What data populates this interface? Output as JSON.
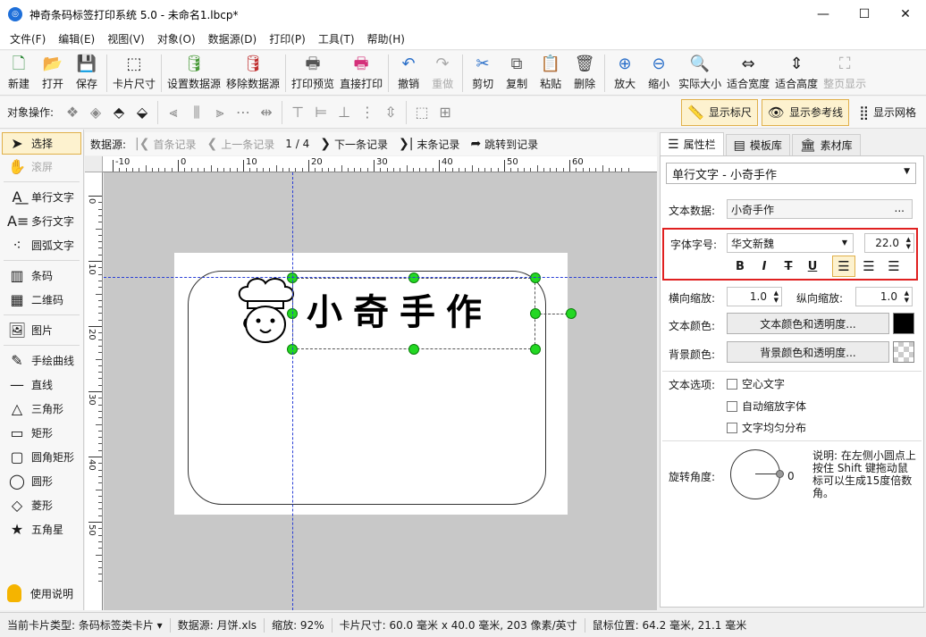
{
  "window": {
    "title": "神奇条码标签打印系统 5.0 - 未命名1.lbcp*",
    "minimize": "—",
    "maximize": "☐",
    "close": "✕"
  },
  "menu": [
    "文件(F)",
    "编辑(E)",
    "视图(V)",
    "对象(O)",
    "数据源(D)",
    "打印(P)",
    "工具(T)",
    "帮助(H)"
  ],
  "toolbar": [
    {
      "label": "新建",
      "icon": "new-file-icon",
      "glyph": "🗋",
      "color": "#2f8a3a"
    },
    {
      "label": "打开",
      "icon": "open-file-icon",
      "glyph": "📂",
      "color": "#2a74c9"
    },
    {
      "label": "保存",
      "icon": "save-icon",
      "glyph": "💾",
      "color": "#7a3fb3"
    },
    {
      "label": "卡片尺寸",
      "icon": "card-size-icon",
      "glyph": "⬚",
      "color": "#222"
    },
    {
      "label": "设置数据源",
      "icon": "set-datasource-icon",
      "glyph": "🛢",
      "color": "#4a9a3a"
    },
    {
      "label": "移除数据源",
      "icon": "remove-datasource-icon",
      "glyph": "🛢",
      "color": "#c03030"
    },
    {
      "label": "打印预览",
      "icon": "print-preview-icon",
      "glyph": "🖶",
      "color": "#555"
    },
    {
      "label": "直接打印",
      "icon": "print-icon",
      "glyph": "🖶",
      "color": "#d4307a"
    },
    {
      "label": "撤销",
      "icon": "undo-icon",
      "glyph": "↶",
      "color": "#2a6fc9"
    },
    {
      "label": "重做",
      "icon": "redo-icon",
      "glyph": "↷",
      "color": "#aaa",
      "disabled": true
    },
    {
      "label": "剪切",
      "icon": "cut-icon",
      "glyph": "✂",
      "color": "#2a6fc9"
    },
    {
      "label": "复制",
      "icon": "copy-icon",
      "glyph": "⧉",
      "color": "#555"
    },
    {
      "label": "粘贴",
      "icon": "paste-icon",
      "glyph": "📋",
      "color": "#b07a2a"
    },
    {
      "label": "删除",
      "icon": "delete-icon",
      "glyph": "🗑",
      "color": "#444"
    },
    {
      "label": "放大",
      "icon": "zoom-in-icon",
      "glyph": "⊕",
      "color": "#2a6fc9"
    },
    {
      "label": "缩小",
      "icon": "zoom-out-icon",
      "glyph": "⊖",
      "color": "#2a6fc9"
    },
    {
      "label": "实际大小",
      "icon": "actual-size-icon",
      "glyph": "🔍",
      "color": "#2a6fc9"
    },
    {
      "label": "适合宽度",
      "icon": "fit-width-icon",
      "glyph": "⇔",
      "color": "#222"
    },
    {
      "label": "适合高度",
      "icon": "fit-height-icon",
      "glyph": "⇕",
      "color": "#222"
    },
    {
      "label": "整页显示",
      "icon": "full-page-icon",
      "glyph": "⛶",
      "color": "#aaa",
      "disabled": true
    }
  ],
  "ops": {
    "label": "对象操作:",
    "toggles": [
      "显示标尺",
      "显示参考线",
      "显示网格"
    ]
  },
  "tools": {
    "select": "选择",
    "scroll": "滚屏",
    "single_text": "单行文字",
    "multi_text": "多行文字",
    "arc_text": "圆弧文字",
    "barcode": "条码",
    "qrcode": "二维码",
    "image": "图片",
    "freehand": "手绘曲线",
    "line": "直线",
    "triangle": "三角形",
    "rect": "矩形",
    "round_rect": "圆角矩形",
    "circle": "圆形",
    "diamond": "菱形",
    "star": "五角星",
    "help": "使用说明"
  },
  "nav": {
    "label": "数据源:",
    "first": "首条记录",
    "prev": "上一条记录",
    "position": "1 / 4",
    "next": "下一条记录",
    "last": "末条记录",
    "jump": "跳转到记录"
  },
  "ruler": {
    "h_labels": [
      "-10",
      "0",
      "10",
      "20",
      "30",
      "40",
      "50",
      "60"
    ],
    "v_labels": [
      "0",
      "10",
      "20",
      "30",
      "40",
      "50"
    ]
  },
  "label": {
    "text": "小奇手作"
  },
  "tabs": [
    "属性栏",
    "模板库",
    "素材库"
  ],
  "props": {
    "object": "单行文字 - 小奇手作",
    "text_data_label": "文本数据:",
    "text_data_value": "小奇手作",
    "text_data_more": "...",
    "font_label": "字体字号:",
    "font_name": "华文新魏",
    "font_size": "22.0",
    "bold": "B",
    "italic": "I",
    "strike": "T",
    "underline": "U",
    "hscale_label": "横向缩放:",
    "hscale_value": "1.0",
    "vscale_label": "纵向缩放:",
    "vscale_value": "1.0",
    "text_color_label": "文本颜色:",
    "text_color_button": "文本颜色和透明度...",
    "text_color": "#000000",
    "bg_color_label": "背景颜色:",
    "bg_color_button": "背景颜色和透明度...",
    "text_options_label": "文本选项:",
    "opt_hollow": "空心文字",
    "opt_autoscale": "自动缩放字体",
    "opt_distribute": "文字均匀分布",
    "rotation_label": "旋转角度:",
    "rotation_value": "0",
    "rotation_note": "说明: 在左侧小圆点上按住 Shift 键拖动鼠标可以生成15度倍数角。"
  },
  "status": {
    "card_type": "当前卡片类型: 条码标签类卡片 ▾",
    "datasource": "数据源: 月饼.xls",
    "zoom": "缩放: 92%",
    "card_size": "卡片尺寸: 60.0 毫米 x 40.0 毫米, 203 像素/英寸",
    "mouse": "鼠标位置: 64.2 毫米, 21.1 毫米"
  },
  "colors": {
    "accent": "#1e6fd9",
    "handle": "#23d823",
    "guide": "#2a3fd6",
    "highlight_border": "#e02020"
  }
}
